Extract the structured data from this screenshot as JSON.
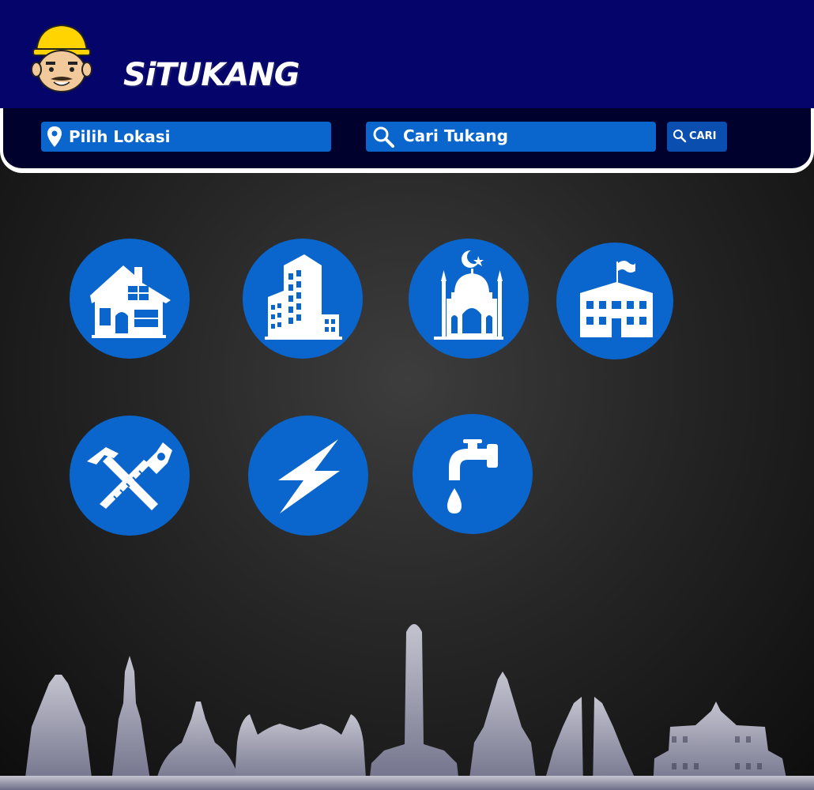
{
  "brand": {
    "name": "SiTUKANG"
  },
  "search": {
    "location_label": "Pilih Lokasi",
    "query_label": "Cari Tukang",
    "submit_label": "CARI"
  },
  "categories": [
    {
      "icon": "house-icon"
    },
    {
      "icon": "office-building-icon"
    },
    {
      "icon": "mosque-icon"
    },
    {
      "icon": "school-building-icon"
    },
    {
      "icon": "hammer-saw-icon"
    },
    {
      "icon": "lightning-icon"
    },
    {
      "icon": "water-faucet-icon"
    }
  ],
  "colors": {
    "header": "#04046a",
    "accent": "#0a66cc",
    "skyline": "#8a8aa0"
  }
}
